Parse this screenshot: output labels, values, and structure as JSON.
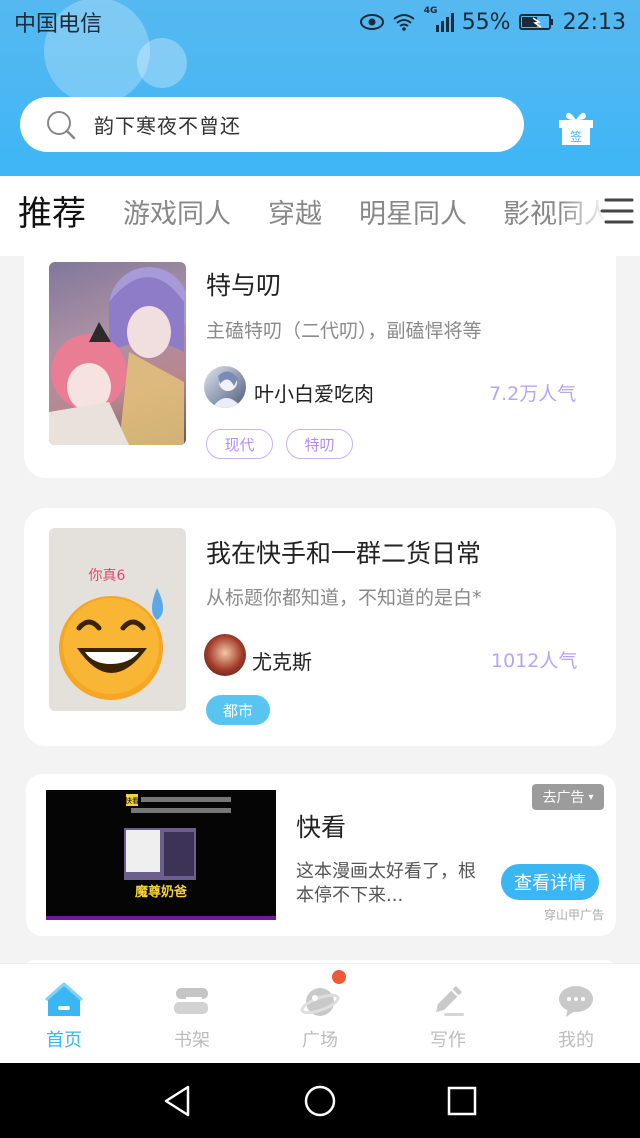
{
  "status_bar": {
    "carrier": "中国电信",
    "network": "4G",
    "battery": "55%",
    "time": "22:13"
  },
  "search": {
    "placeholder": "韵下寒夜不曾还",
    "icon": "search-icon"
  },
  "gift": {
    "label": "签",
    "icon": "gift-icon"
  },
  "tabs": [
    {
      "label": "推荐",
      "active": true
    },
    {
      "label": "游戏同人",
      "active": false
    },
    {
      "label": "穿越",
      "active": false
    },
    {
      "label": "明星同人",
      "active": false
    },
    {
      "label": "影视同人",
      "active": false
    }
  ],
  "cards": [
    {
      "title": "特与叨",
      "description": "主磕特叨（二代叨），副磕悍将等",
      "author": "叶小白爱吃肉",
      "popularity": "7.2万人气",
      "tags": [
        "现代",
        "特叨"
      ]
    },
    {
      "title": "我在快手和一群二货日常",
      "description": "从标题你都知道，不知道的是白*",
      "author": "尤克斯",
      "popularity": "1012人气",
      "tags": [
        "都市"
      ],
      "cover_text": "你真6"
    }
  ],
  "ad": {
    "title": "快看",
    "description": "这本漫画太好看了，根本停不下来...",
    "button": "查看详情",
    "close_label": "去广告",
    "source": "穿山甲广告",
    "image_caption": "魔尊奶爸",
    "image_logo": "快看"
  },
  "bottom_nav": [
    {
      "label": "首页",
      "icon": "home-icon",
      "active": true
    },
    {
      "label": "书架",
      "icon": "bookshelf-icon",
      "active": false
    },
    {
      "label": "广场",
      "icon": "planet-icon",
      "active": false,
      "badge": true
    },
    {
      "label": "写作",
      "icon": "pen-icon",
      "active": false
    },
    {
      "label": "我的",
      "icon": "chat-bubble-icon",
      "active": false
    }
  ],
  "colors": {
    "accent": "#3ab7f3",
    "header": "#4db8f3",
    "purple": "#b9a3f4",
    "badge": "#ef5a3a"
  }
}
